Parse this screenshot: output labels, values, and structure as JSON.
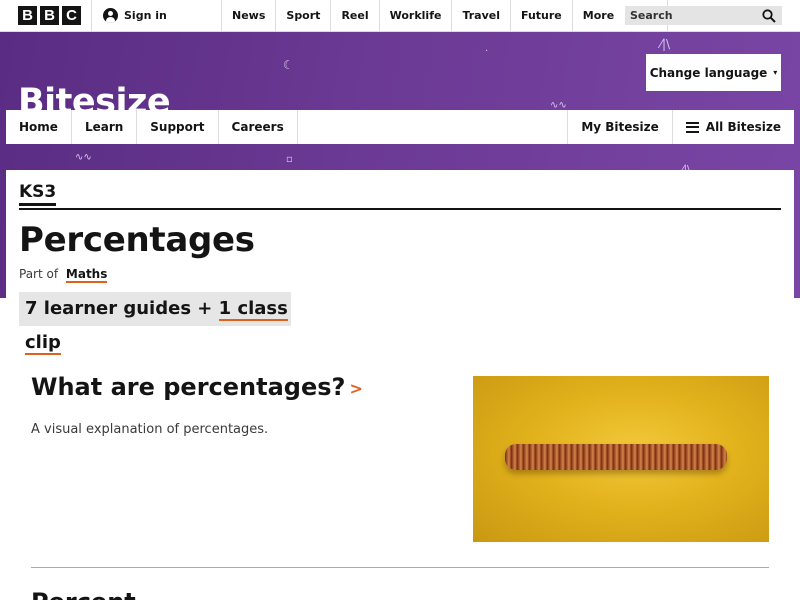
{
  "brand_bar": {
    "logo_letters": [
      "B",
      "B",
      "C"
    ],
    "sign_in": "Sign in",
    "nav": [
      "News",
      "Sport",
      "Reel",
      "Worklife",
      "Travel",
      "Future",
      "More"
    ],
    "more_caret": "▾",
    "search_placeholder": "Search"
  },
  "masthead": {
    "brand": "Bitesize",
    "change_language": "Change language",
    "caret": "▾",
    "background_color": "#6b3a94"
  },
  "bitesize_nav": {
    "left": [
      "Home",
      "Learn",
      "Support",
      "Careers"
    ],
    "my_bitesize": "My Bitesize",
    "all_bitesize": "All Bitesize"
  },
  "topic": {
    "level": "KS3",
    "title": "Percentages",
    "part_of_prefix": "Part of",
    "part_of_link": "Maths",
    "guides_text": "7 learner guides + ",
    "clips_link": "1 class clip",
    "accent_color": "#e0621a"
  },
  "guides": [
    {
      "title": "What are percentages?",
      "chevron": ">",
      "description": "A visual explanation of percentages.",
      "image_icon": "coins-image"
    }
  ],
  "next_guide_partial": "Percent"
}
